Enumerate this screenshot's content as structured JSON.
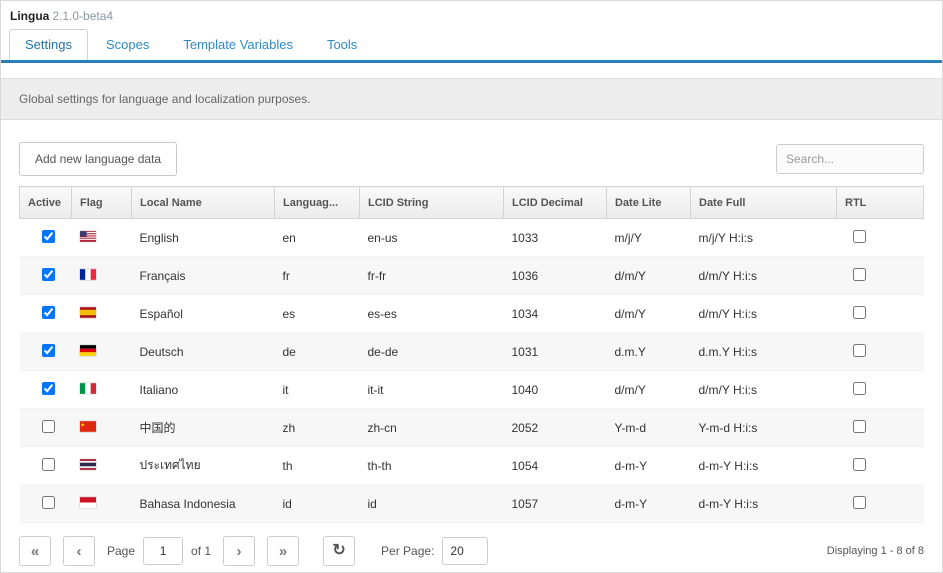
{
  "header": {
    "app_name": "Lingua",
    "version": "2.1.0-beta4"
  },
  "tabs": [
    {
      "label": "Settings",
      "active": true
    },
    {
      "label": "Scopes",
      "active": false
    },
    {
      "label": "Template Variables",
      "active": false
    },
    {
      "label": "Tools",
      "active": false
    }
  ],
  "description": "Global settings for language and localization purposes.",
  "toolbar": {
    "add_button": "Add new language data",
    "search_placeholder": "Search..."
  },
  "table": {
    "columns": [
      "Active",
      "Flag",
      "Local Name",
      "Languag...",
      "LCID String",
      "LCID Decimal",
      "Date Lite",
      "Date Full",
      "RTL"
    ],
    "rows": [
      {
        "active": true,
        "flag": "us",
        "local_name": "English",
        "language": "en",
        "lcid_string": "en-us",
        "lcid_decimal": "1033",
        "date_lite": "m/j/Y",
        "date_full": "m/j/Y H:i:s",
        "rtl": false
      },
      {
        "active": true,
        "flag": "fr",
        "local_name": "Français",
        "language": "fr",
        "lcid_string": "fr-fr",
        "lcid_decimal": "1036",
        "date_lite": "d/m/Y",
        "date_full": "d/m/Y H:i:s",
        "rtl": false
      },
      {
        "active": true,
        "flag": "es",
        "local_name": "Español",
        "language": "es",
        "lcid_string": "es-es",
        "lcid_decimal": "1034",
        "date_lite": "d/m/Y",
        "date_full": "d/m/Y H:i:s",
        "rtl": false
      },
      {
        "active": true,
        "flag": "de",
        "local_name": "Deutsch",
        "language": "de",
        "lcid_string": "de-de",
        "lcid_decimal": "1031",
        "date_lite": "d.m.Y",
        "date_full": "d.m.Y H:i:s",
        "rtl": false
      },
      {
        "active": true,
        "flag": "it",
        "local_name": "Italiano",
        "language": "it",
        "lcid_string": "it-it",
        "lcid_decimal": "1040",
        "date_lite": "d/m/Y",
        "date_full": "d/m/Y H:i:s",
        "rtl": false
      },
      {
        "active": false,
        "flag": "cn",
        "local_name": "中国的",
        "language": "zh",
        "lcid_string": "zh-cn",
        "lcid_decimal": "2052",
        "date_lite": "Y-m-d",
        "date_full": "Y-m-d H:i:s",
        "rtl": false
      },
      {
        "active": false,
        "flag": "th",
        "local_name": "ประเทศไทย",
        "language": "th",
        "lcid_string": "th-th",
        "lcid_decimal": "1054",
        "date_lite": "d-m-Y",
        "date_full": "d-m-Y H:i:s",
        "rtl": false
      },
      {
        "active": false,
        "flag": "id",
        "local_name": "Bahasa Indonesia",
        "language": "id",
        "lcid_string": "id",
        "lcid_decimal": "1057",
        "date_lite": "d-m-Y",
        "date_full": "d-m-Y H:i:s",
        "rtl": false
      }
    ]
  },
  "icons": {
    "first": "«",
    "prev": "‹",
    "next": "›",
    "last": "»",
    "refresh": "↻"
  },
  "pagination": {
    "page_label": "Page",
    "page_value": "1",
    "of_label": "of 1",
    "per_page_label": "Per Page:",
    "per_page_value": "20",
    "displaying": "Displaying 1 - 8 of 8"
  }
}
